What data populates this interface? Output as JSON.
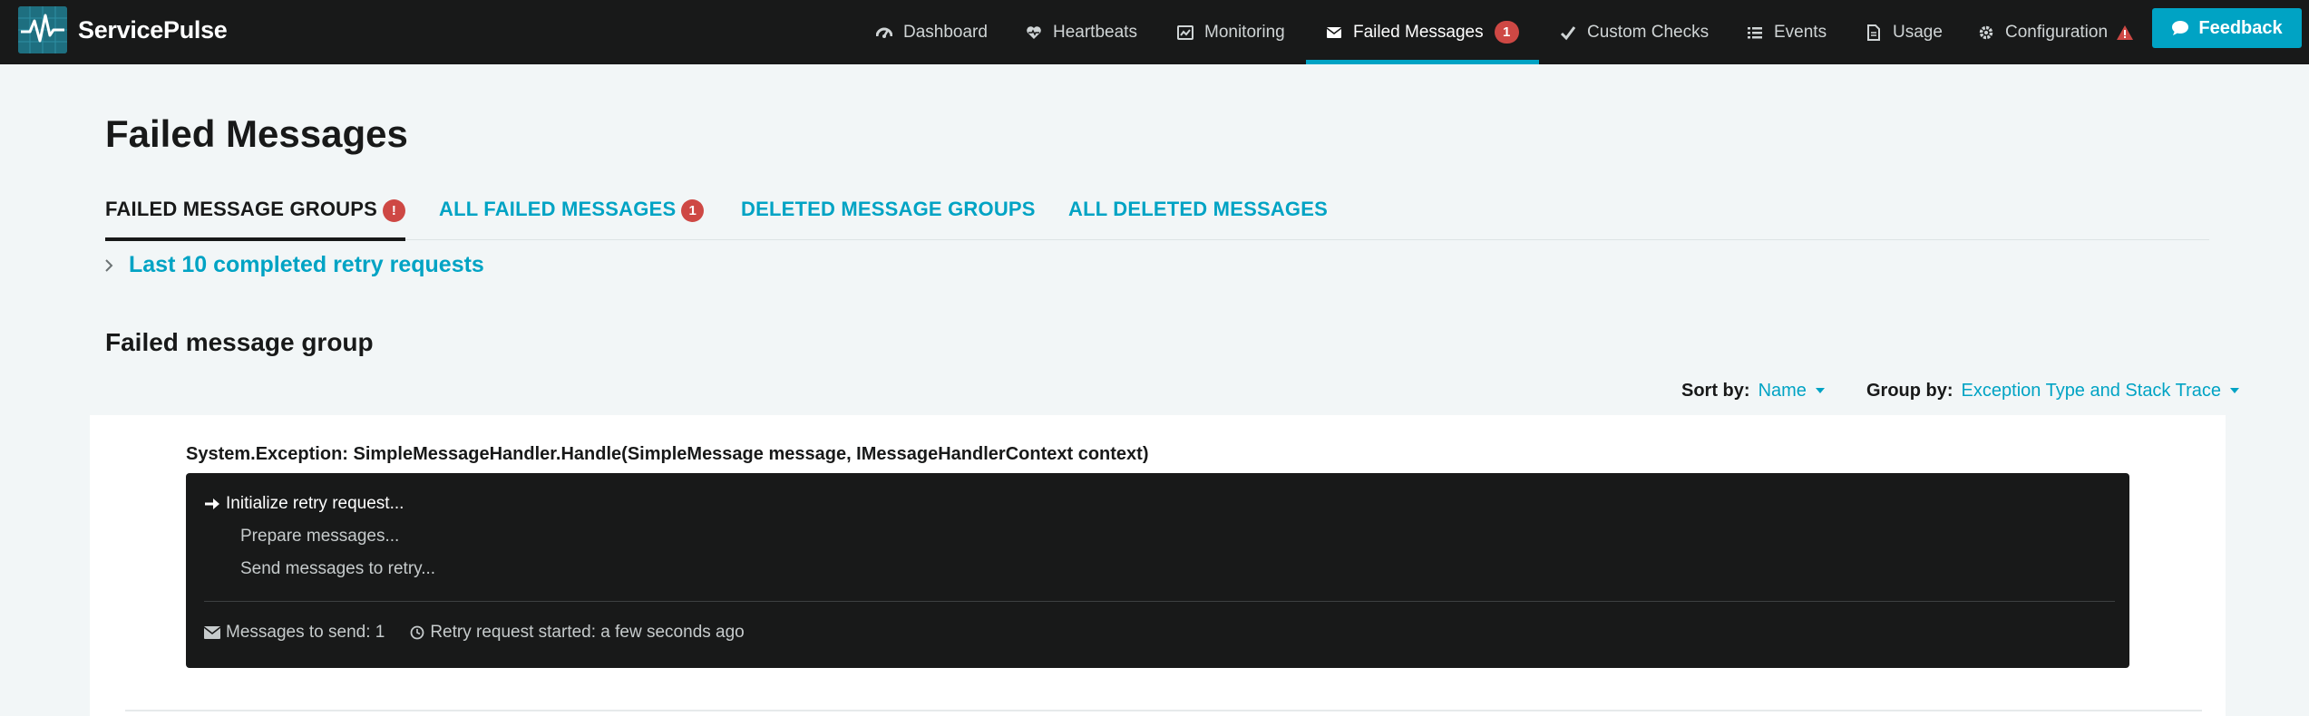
{
  "app": {
    "name": "ServicePulse"
  },
  "nav": {
    "items": [
      {
        "label": "Dashboard",
        "icon": "dashboard-icon"
      },
      {
        "label": "Heartbeats",
        "icon": "heartbeat-icon"
      },
      {
        "label": "Monitoring",
        "icon": "monitoring-icon"
      },
      {
        "label": "Failed Messages",
        "icon": "envelope-icon",
        "badge": "1",
        "active": true
      },
      {
        "label": "Custom Checks",
        "icon": "check-icon"
      },
      {
        "label": "Events",
        "icon": "list-icon"
      },
      {
        "label": "Usage",
        "icon": "document-icon"
      },
      {
        "label": "Configuration",
        "icon": "gear-icon",
        "warning": true
      }
    ],
    "feedback_label": "Feedback"
  },
  "page": {
    "title": "Failed Messages",
    "tabs": [
      {
        "label": "Failed Message Groups",
        "badge": "!",
        "active": true
      },
      {
        "label": "All Failed Messages",
        "badge": "1"
      },
      {
        "label": "Deleted Message Groups"
      },
      {
        "label": "All Deleted Messages"
      }
    ],
    "retry_history_link": "Last 10 completed retry requests",
    "section_title": "Failed message group",
    "sort": {
      "label": "Sort by:",
      "value": "Name"
    },
    "group": {
      "label": "Group by:",
      "value": "Exception Type and Stack Trace"
    }
  },
  "group_card": {
    "title": "System.Exception: SimpleMessageHandler.Handle(SimpleMessage message, IMessageHandlerContext context)",
    "steps": {
      "current": "Initialize retry request...",
      "prepare": "Prepare messages...",
      "send": "Send messages to retry..."
    },
    "messages_to_send": "Messages to send: 1",
    "retry_started": "Retry request started: a few seconds ago"
  },
  "colors": {
    "navbar": "#181919",
    "accent": "#00a3c4",
    "badge": "#ce4844",
    "background": "#f2f6f7",
    "panel": "#181919"
  }
}
